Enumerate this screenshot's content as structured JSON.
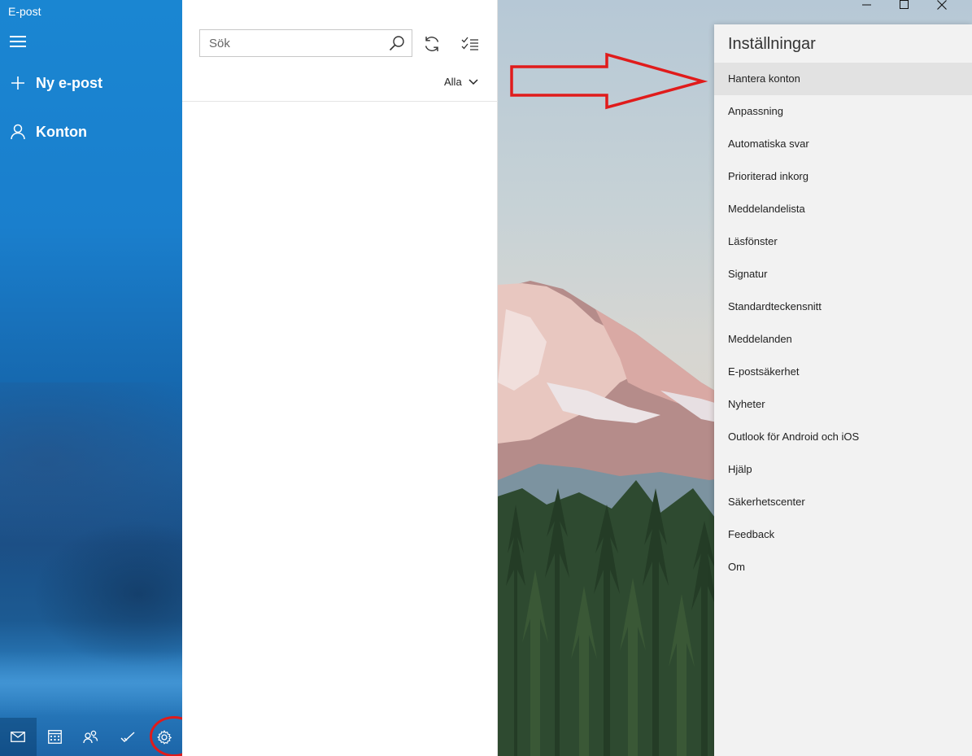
{
  "app": {
    "title": "E-post"
  },
  "nav": {
    "items": [
      {
        "icon": "plus-icon",
        "label": "Ny e-post"
      },
      {
        "icon": "person-icon",
        "label": "Konton"
      }
    ],
    "bottom_bar": [
      "mail-icon",
      "calendar-icon",
      "people-icon",
      "todo-icon",
      "gear-icon"
    ],
    "active_bottom": "mail-icon",
    "highlight_color": "#e01b1b"
  },
  "search": {
    "placeholder": "Sök"
  },
  "filter": {
    "label": "Alla"
  },
  "settings": {
    "title": "Inställningar",
    "items": [
      "Hantera konton",
      "Anpassning",
      "Automatiska svar",
      "Prioriterad inkorg",
      "Meddelandelista",
      "Läsfönster",
      "Signatur",
      "Standardteckensnitt",
      "Meddelanden",
      "E-postsäkerhet",
      "Nyheter",
      "Outlook för Android och iOS",
      "Hjälp",
      "Säkerhetscenter",
      "Feedback",
      "Om"
    ],
    "hovered_item": "Hantera konton"
  },
  "colors": {
    "accent": "#1a7fcd",
    "annotation": "#e01b1b"
  }
}
